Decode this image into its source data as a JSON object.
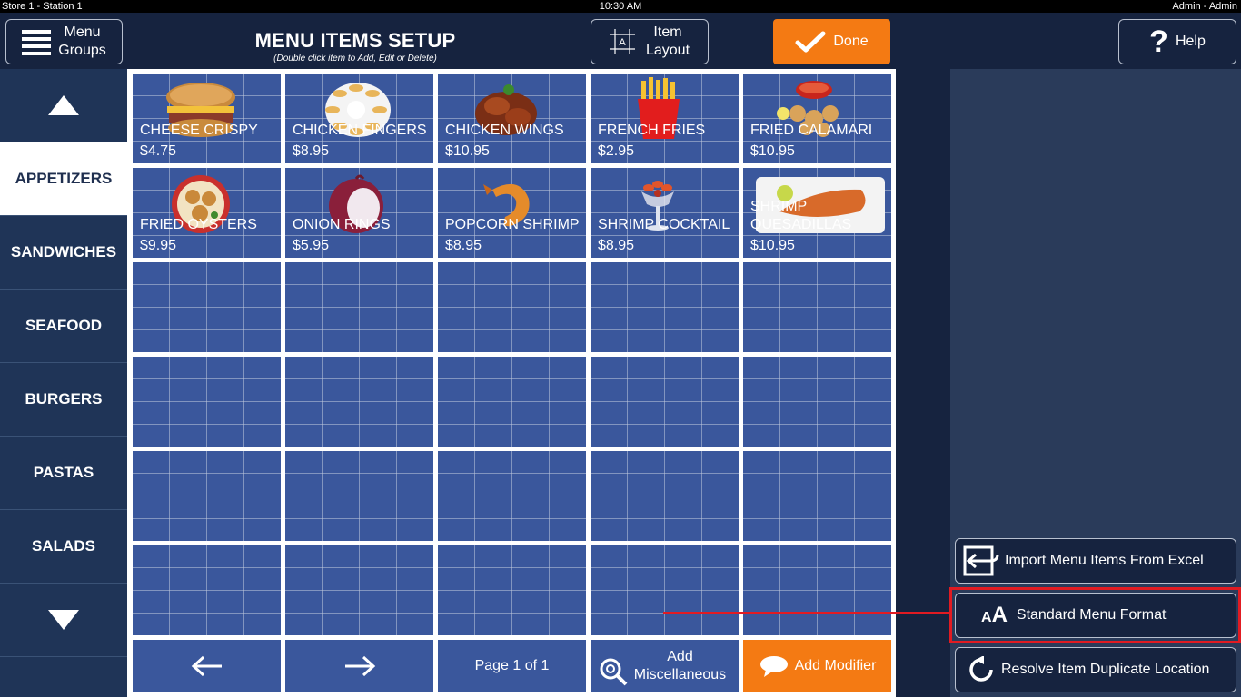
{
  "status": {
    "left": "Store 1 - Station 1",
    "time": "10:30 AM",
    "right": "Admin - Admin"
  },
  "header": {
    "menu_groups_label_1": "Menu",
    "menu_groups_label_2": "Groups",
    "title": "MENU ITEMS SETUP",
    "subtitle": "(Double click item to Add, Edit or Delete)",
    "item_layout_1": "Item",
    "item_layout_2": "Layout",
    "done_label": "Done",
    "help_label": "Help"
  },
  "sidebar": {
    "items": [
      {
        "label": "APPETIZERS",
        "active": true
      },
      {
        "label": "SANDWICHES"
      },
      {
        "label": "SEAFOOD"
      },
      {
        "label": "BURGERS"
      },
      {
        "label": "PASTAS"
      },
      {
        "label": "SALADS"
      }
    ]
  },
  "menu_items": [
    {
      "name": "CHEESE CRISPY",
      "price": "$4.75",
      "icon": "bagel-sandwich-icon"
    },
    {
      "name": "CHICKEN FINGERS",
      "price": "$8.95",
      "icon": "chicken-fingers-icon"
    },
    {
      "name": "CHICKEN WINGS",
      "price": "$10.95",
      "icon": "chicken-wings-icon"
    },
    {
      "name": "FRENCH FRIES",
      "price": "$2.95",
      "icon": "french-fries-icon"
    },
    {
      "name": "FRIED CALAMARI",
      "price": "$10.95",
      "icon": "calamari-icon"
    },
    {
      "name": "FRIED OYSTERS",
      "price": "$9.95",
      "icon": "oysters-icon"
    },
    {
      "name": "ONION RINGS",
      "price": "$5.95",
      "icon": "onion-icon"
    },
    {
      "name": "POPCORN SHRIMP",
      "price": "$8.95",
      "icon": "shrimp-icon"
    },
    {
      "name": "SHRIMP COCKTAIL",
      "price": "$8.95",
      "icon": "shrimp-cocktail-icon"
    },
    {
      "name": "SHRIMP QUESADILLAS",
      "price": "$10.95",
      "icon": "quesadilla-icon"
    }
  ],
  "bottom": {
    "page_label": "Page 1 of 1",
    "add_misc_1": "Add",
    "add_misc_2": "Miscellaneous",
    "add_modifier": "Add Modifier"
  },
  "right_panel": {
    "import_label": "Import Menu Items From Excel",
    "standard_format_label": "Standard Menu Format",
    "resolve_label": "Resolve Item Duplicate Location"
  },
  "colors": {
    "orange": "#f47a13",
    "cell_blue": "#3a579c",
    "highlight_red": "#e11b22"
  }
}
